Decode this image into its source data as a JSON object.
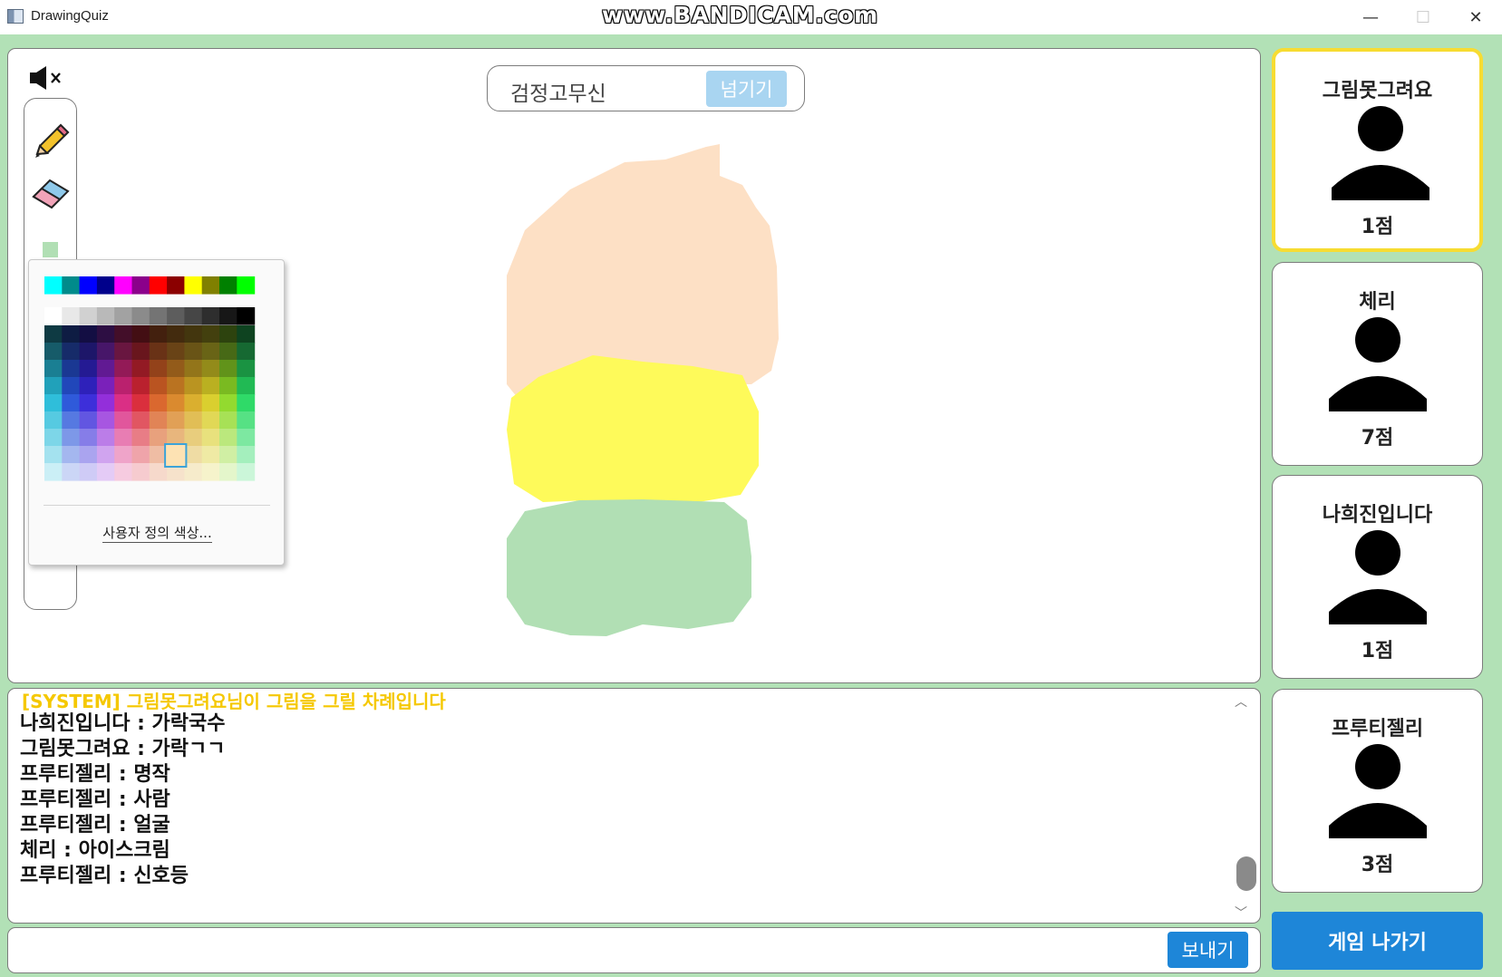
{
  "window": {
    "title": "DrawingQuiz",
    "watermark": "www.BANDICAM.com",
    "minimize": "—",
    "maximize": "☐",
    "close": "✕"
  },
  "word": {
    "answer": "검정고무신",
    "skip_label": "넘기기"
  },
  "tools": {
    "selected_color": "#b1dfb4"
  },
  "palette": {
    "custom_color_label": "사용자 정의 색상..."
  },
  "chat": {
    "system_message": "[SYSTEM] 그림못그려요님이 그림을 그릴 차례입니다",
    "messages": [
      {
        "text": "나희진입니다 : 가락국수"
      },
      {
        "text": "그림못그려요 : 가락ㄱㄱ"
      },
      {
        "text": "프루티젤리 : 명작"
      },
      {
        "text": "프루티젤리 : 사람"
      },
      {
        "text": "프루티젤리 : 얼굴"
      },
      {
        "text": "체리 : 아이스크림"
      },
      {
        "text": "프루티젤리 : 신호등"
      }
    ],
    "input_value": "",
    "send_label": "보내기"
  },
  "players": [
    {
      "name": "그림못그려요",
      "score": "1점"
    },
    {
      "name": "체리",
      "score": "7점"
    },
    {
      "name": "나희진입니다",
      "score": "1점"
    },
    {
      "name": "프루티젤리",
      "score": "3점"
    }
  ],
  "exit_label": "게임 나가기",
  "colors": {
    "background": "#b2e1b6",
    "accent_blue": "#1e86d8",
    "skip_blue": "#a9d5f1",
    "active_border": "#f7dc32",
    "drawing_peach": "#fde0c5",
    "drawing_yellow": "#fefa5a",
    "drawing_green": "#b1dfb4"
  }
}
